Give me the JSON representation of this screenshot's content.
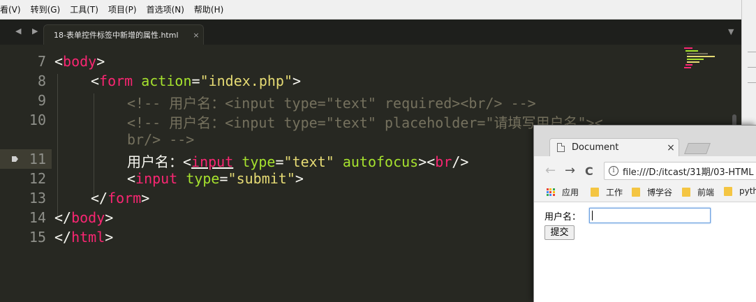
{
  "menu": [
    "看(V)",
    "转到(G)",
    "工具(T)",
    "项目(P)",
    "首选项(N)",
    "帮助(H)"
  ],
  "editor_tab": {
    "title": "18-表单控件标签中新增的属性.html",
    "close": "×"
  },
  "nav_arrows": "◀ ▶",
  "tab_dropdown": "▼",
  "gutter_numbers": [
    "7",
    "8",
    "9",
    "10",
    "",
    "11",
    "12",
    "13",
    "14",
    "15"
  ],
  "code": {
    "l7_open": "<",
    "l7_tag": "body",
    "l7_close": ">",
    "l8_open": "<",
    "l8_tag": "form",
    "l8_attr": "action",
    "l8_eq": "=",
    "l8_val": "\"index.php\"",
    "l8_close": ">",
    "l9_comment": "<!-- 用户名：<input type=\"text\" required><br/> -->",
    "l10_comment": "<!-- 用户名：<input type=\"text\" placeholder=\"请填写用户名\"><",
    "l10b_comment": "br/> -->",
    "l11_text": "用户名：",
    "l11_open": "<",
    "l11_tag": "input",
    "l11_attr1": "type",
    "l11_eq": "=",
    "l11_val": "\"text\"",
    "l11_attr2": "autofocus",
    "l11_close": ">",
    "l11_br_open": "<",
    "l11_br": "br",
    "l11_br_close": "/>",
    "l12_open": "<",
    "l12_tag": "input",
    "l12_attr": "type",
    "l12_eq": "=",
    "l12_val": "\"submit\"",
    "l12_close": ">",
    "l13_open": "</",
    "l13_tag": "form",
    "l13_close": ">",
    "l14_open": "</",
    "l14_tag": "body",
    "l14_close": ">",
    "l15_open": "</",
    "l15_tag": "html",
    "l15_close": ">"
  },
  "browser": {
    "tab_title": "Document",
    "tab_close": "×",
    "back": "←",
    "forward": "→",
    "reload": "C",
    "info": "i",
    "url": "file:///D:/itcast/31期/03-HTML",
    "bookmarks": [
      "应用",
      "工作",
      "博学谷",
      "前端",
      "pyth"
    ],
    "field_label": "用户名：",
    "submit_label": "提交"
  },
  "colors": {
    "tag": "#f92672",
    "attr": "#a6e22e",
    "string": "#e6db74",
    "comment": "#75715e",
    "bg": "#272822"
  }
}
